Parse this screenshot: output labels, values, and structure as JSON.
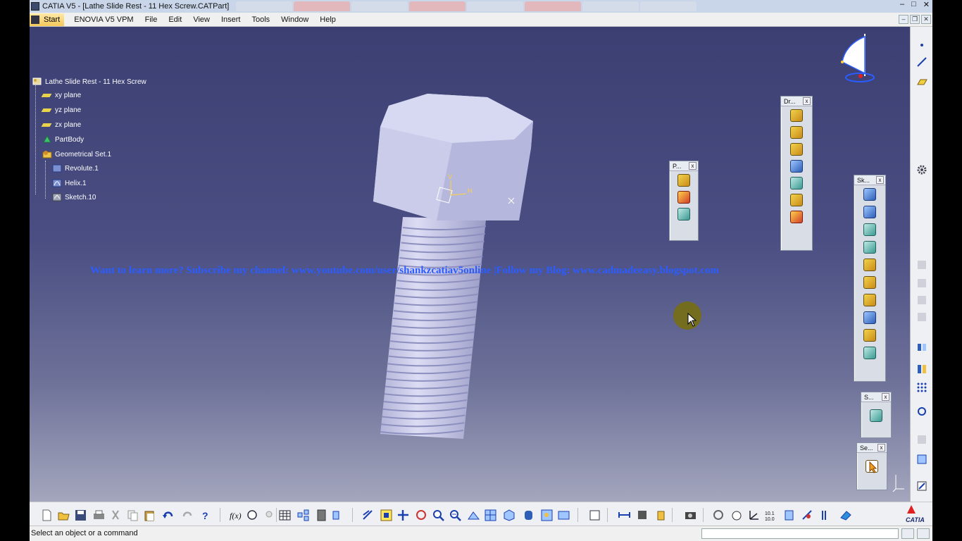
{
  "window": {
    "title": "CATIA V5 - [Lathe Slide Rest - 11 Hex Screw.CATPart]",
    "controls": [
      "–",
      "□",
      "✕"
    ]
  },
  "menu": {
    "start": "Start",
    "items": [
      "ENOVIA V5 VPM",
      "File",
      "Edit",
      "View",
      "Insert",
      "Tools",
      "Window",
      "Help"
    ]
  },
  "tree": {
    "root": "Lathe Slide Rest - 11 Hex Screw",
    "nodes": [
      {
        "label": "xy plane",
        "icon": "plane-icon"
      },
      {
        "label": "yz plane",
        "icon": "plane-icon"
      },
      {
        "label": "zx plane",
        "icon": "plane-icon"
      },
      {
        "label": "PartBody",
        "icon": "partbody-icon"
      },
      {
        "label": "Geometrical Set.1",
        "icon": "geometrical-set-icon"
      },
      {
        "label": "Revolute.1",
        "icon": "revolute-icon"
      },
      {
        "label": "Helix.1",
        "icon": "helix-icon"
      },
      {
        "label": "Sketch.10",
        "icon": "sketch-icon"
      }
    ]
  },
  "watermark": "Want to learn more? Subscribe my channel: www.youtube.com/user/shankzcatiav5online |Follow my Blog: www.cadmadeeasy.blogspot.com",
  "axis_labels": {
    "v": "V",
    "h": "H"
  },
  "toolbars": [
    {
      "title": "P...",
      "close": "x"
    },
    {
      "title": "Dr...",
      "close": "x"
    },
    {
      "title": "Sk...",
      "close": "x"
    },
    {
      "title": "S...",
      "close": "x"
    },
    {
      "title": "Se...",
      "close": "x"
    }
  ],
  "statusbar": {
    "message": "Select an object or a command"
  },
  "brand": "CATIA",
  "colors": {
    "background_top": "#3b3f72",
    "background_bottom": "#a4a6bd",
    "watermark": "#2b5cff",
    "model": "#c8c9e8"
  }
}
